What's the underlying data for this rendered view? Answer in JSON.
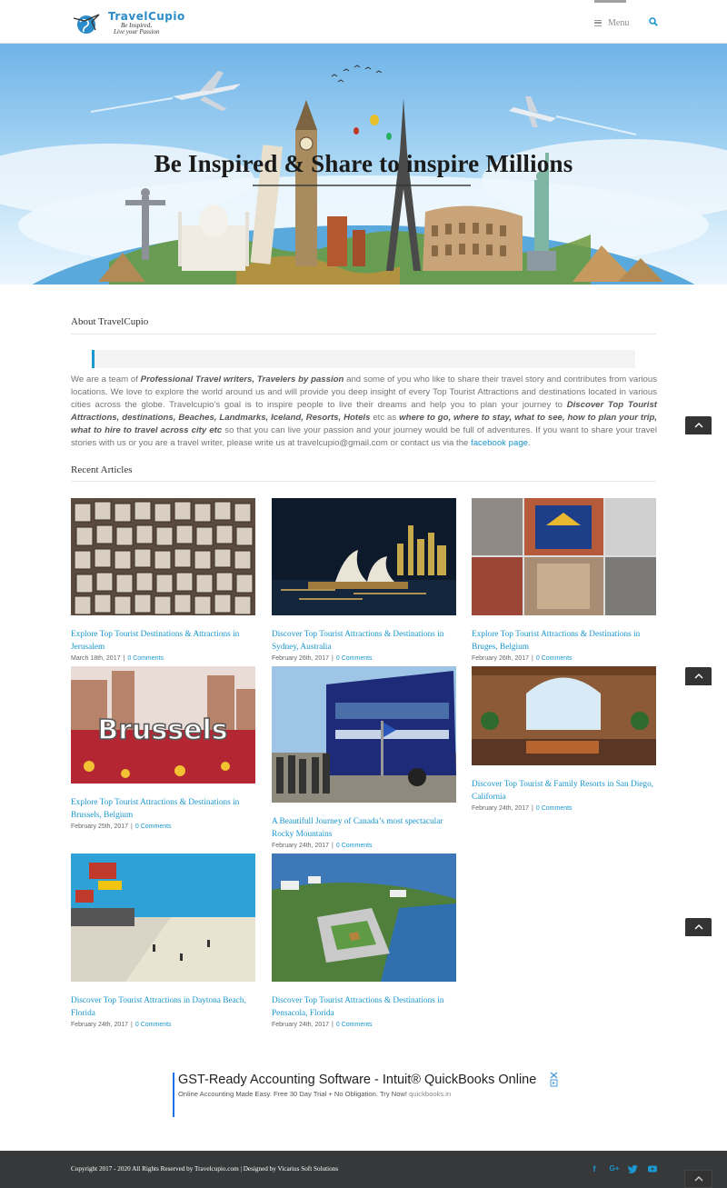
{
  "header": {
    "logo_title": "TravelCupio",
    "logo_tagline_1": "Be Inspired,",
    "logo_tagline_2": "Live your Passion",
    "menu_label": "Menu"
  },
  "hero": {
    "title": "Be Inspired & Share to inspire Millions"
  },
  "about": {
    "heading": "About TravelCupio",
    "text_parts": {
      "p1": "We are a team of ",
      "b1": "Professional Travel writers, Travelers by passion",
      "p2": " and some of you who like to share their travel story and contributes from various locations. We love to explore the world around us and will provide you deep insight of every Top Tourist Attractions and destinations located in various cities across the globe. Travelcupio’s goal is to inspire people to live their dreams and help you to plan your journey to ",
      "b2": "Discover Top Tourist Attractions, destinations, Beaches, Landmarks, Iceland, Resorts, Hotels",
      "p3": " etc as ",
      "b3": "where to go, where to stay, what to see, how to plan your trip, what to hire to travel across city etc",
      "p4": " so that you can live your passion and your journey would be full of adventures. If you want to share your travel stories with us or you are a travel writer, please write us at travelcupio@gmail.com or contact us via the ",
      "link": "facebook page",
      "p5": "."
    }
  },
  "recent": {
    "heading": "Recent Articles",
    "articles": [
      {
        "title": "Explore Top Tourist Destinations & Attractions in Jerusalem",
        "date": "March 18th, 2017",
        "comments": "0 Comments"
      },
      {
        "title": "Discover Top Tourist Attractions & Destinations in Sydney, Australia",
        "date": "February 26th, 2017",
        "comments": "0 Comments"
      },
      {
        "title": "Explore Top Tourist Attractions & Destinations in Bruges, Belgium",
        "date": "February 26th, 2017",
        "comments": "0 Comments"
      },
      {
        "title": "Explore Top Tourist Attractions & Destinations in Brussels, Belgium",
        "date": "February 25th, 2017",
        "comments": "0 Comments"
      },
      {
        "title": "A Beautifull Journey of Canada’s most spectacular Rocky Mountains",
        "date": "February 24th, 2017",
        "comments": "0 Comments"
      },
      {
        "title": "Discover Top Tourist & Family Resorts in San Diego, California",
        "date": "February 24th, 2017",
        "comments": "0 Comments"
      },
      {
        "title": "Discover Top Tourist Attractions in Daytona Beach, Florida",
        "date": "February 24th, 2017",
        "comments": "0 Comments"
      },
      {
        "title": "Discover Top Tourist Attractions & Destinations in Pensacola, Florida",
        "date": "February 24th, 2017",
        "comments": "0 Comments"
      }
    ],
    "meta_separator": "|"
  },
  "ad": {
    "title": "GST-Ready Accounting Software - Intuit® QuickBooks Online",
    "description": "Online Accounting Made Easy. Free 30 Day Trial + No Obligation. Try Now!",
    "domain": "quickbooks.in"
  },
  "footer": {
    "copyright": "Copyright 2017 - 2020 All Rights Reserved by Travelcupio.com | Designed by Vicarius Soft Solutions",
    "social_icons": [
      "facebook-icon",
      "google-plus-icon",
      "twitter-icon",
      "youtube-icon"
    ]
  },
  "colors": {
    "accent": "#1a97ce",
    "footer_bg": "#363839",
    "text": "#747474"
  }
}
